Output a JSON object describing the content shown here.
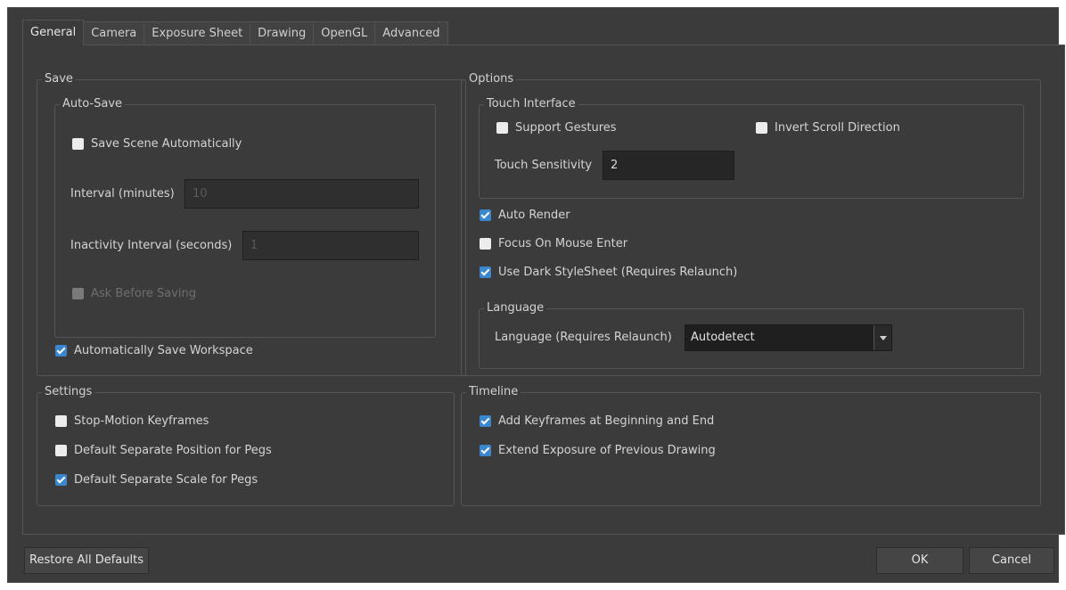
{
  "tabs": [
    {
      "label": "General",
      "active": true
    },
    {
      "label": "Camera"
    },
    {
      "label": "Exposure Sheet"
    },
    {
      "label": "Drawing"
    },
    {
      "label": "OpenGL"
    },
    {
      "label": "Advanced"
    }
  ],
  "save": {
    "title": "Save",
    "autosave": {
      "title": "Auto-Save",
      "save_scene_auto": {
        "label": "Save Scene Automatically",
        "checked": false
      },
      "interval_label": "Interval (minutes)",
      "interval_value": "10",
      "inactivity_label": "Inactivity Interval (seconds)",
      "inactivity_value": "1",
      "ask_before_saving": {
        "label": "Ask Before Saving",
        "checked": false,
        "disabled": true
      }
    },
    "auto_save_workspace": {
      "label": "Automatically Save Workspace",
      "checked": true
    }
  },
  "options": {
    "title": "Options",
    "touch": {
      "title": "Touch Interface",
      "support_gestures": {
        "label": "Support Gestures",
        "checked": false
      },
      "invert_scroll": {
        "label": "Invert Scroll Direction",
        "checked": false
      },
      "sensitivity_label": "Touch Sensitivity",
      "sensitivity_value": "2"
    },
    "auto_render": {
      "label": "Auto Render",
      "checked": true
    },
    "focus_mouse": {
      "label": "Focus On Mouse Enter",
      "checked": false
    },
    "dark_style": {
      "label": "Use Dark StyleSheet (Requires Relaunch)",
      "checked": true
    },
    "language": {
      "title": "Language",
      "label": "Language (Requires Relaunch)",
      "value": "Autodetect"
    }
  },
  "settings": {
    "title": "Settings",
    "stop_motion": {
      "label": "Stop-Motion Keyframes",
      "checked": false
    },
    "sep_position": {
      "label": "Default Separate Position for Pegs",
      "checked": false
    },
    "sep_scale": {
      "label": "Default Separate Scale for Pegs",
      "checked": true
    }
  },
  "timeline": {
    "title": "Timeline",
    "add_keyframes": {
      "label": "Add Keyframes at Beginning and End",
      "checked": true
    },
    "extend_exposure": {
      "label": "Extend Exposure of Previous Drawing",
      "checked": true
    }
  },
  "buttons": {
    "restore": "Restore All Defaults",
    "ok": "OK",
    "cancel": "Cancel"
  }
}
